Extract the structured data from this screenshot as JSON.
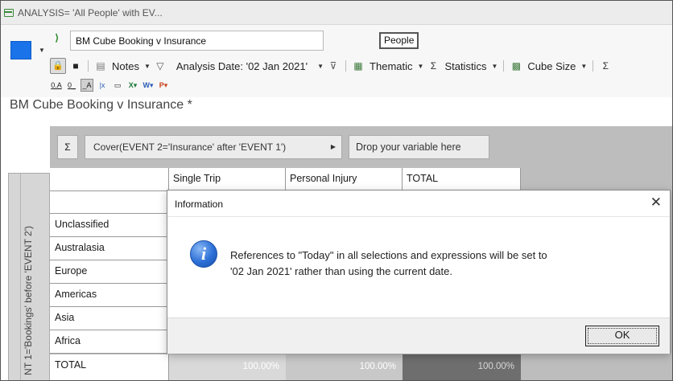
{
  "window": {
    "title": "ANALYSIS= 'All People' with EV..."
  },
  "toolbar": {
    "name_value": "BM Cube Booking v Insurance",
    "people_label": "People",
    "notes_label": "Notes",
    "analysis_date_label": "Analysis Date: '02 Jan 2021'",
    "thematic_label": "Thematic",
    "statistics_label": "Statistics",
    "cube_size_label": "Cube Size",
    "accent_color": "#1a73e8"
  },
  "report": {
    "title": "BM Cube Booking v Insurance *"
  },
  "pivot": {
    "sigma_label": "Σ",
    "cover_label": "Cover(EVENT 2='Insurance' after 'EVENT 1')",
    "drop_label": "Drop your variable here",
    "side_label": "NT 1='Bookings' before 'EVENT 2')",
    "columns": [
      "Single Trip",
      "Personal Injury",
      "TOTAL"
    ],
    "rows": [
      "Unclassified",
      "Australasia",
      "Europe",
      "Americas",
      "Asia",
      "Africa",
      "TOTAL"
    ],
    "totals": [
      "100.00%",
      "100.00%",
      "100.00%"
    ]
  },
  "dialog": {
    "title": "Information",
    "message_line1": "References to \"Today\" in all selections and expressions will be set to",
    "message_line2": "'02 Jan 2021' rather than using the current date.",
    "ok_label": "OK"
  }
}
